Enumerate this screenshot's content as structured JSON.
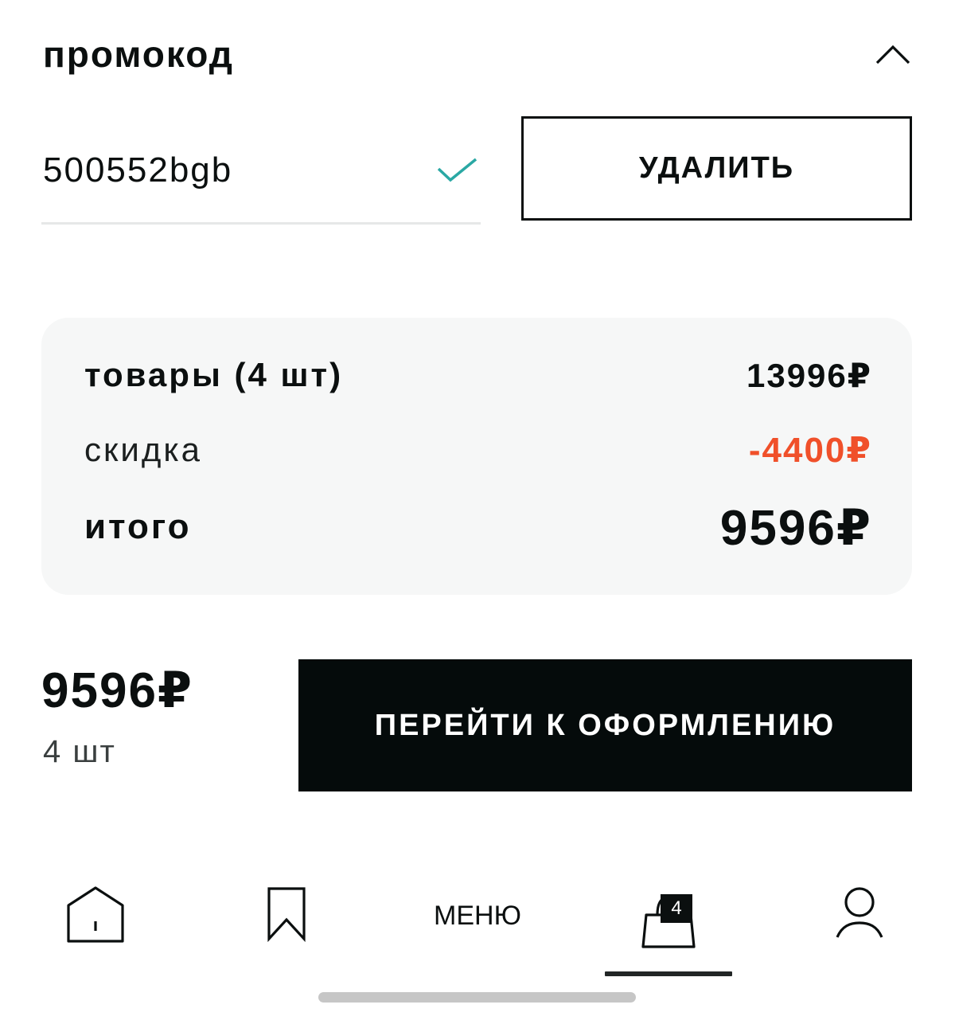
{
  "promo": {
    "title": "промокод",
    "code_value": "500552bgb",
    "delete_label": "УДАЛИТЬ",
    "check_color": "#2aa8a4"
  },
  "summary": {
    "goods_label": "товары (4 шт)",
    "goods_value": "13996₽",
    "discount_label": "скидка",
    "discount_value": "-4400₽",
    "discount_color": "#f0502a",
    "total_label": "итого",
    "total_value": "9596₽"
  },
  "checkout": {
    "price": "9596₽",
    "quantity": "4 шт",
    "button_label": "ПЕРЕЙТИ К ОФОРМЛЕНИЮ"
  },
  "nav": {
    "items": [
      {
        "name": "home",
        "icon": "home-icon"
      },
      {
        "name": "favorites",
        "icon": "bookmark-icon"
      },
      {
        "name": "menu",
        "label": "МЕНЮ"
      },
      {
        "name": "cart",
        "icon": "shopping-bag-icon",
        "badge": "4",
        "active": true
      },
      {
        "name": "profile",
        "icon": "user-icon"
      }
    ]
  }
}
